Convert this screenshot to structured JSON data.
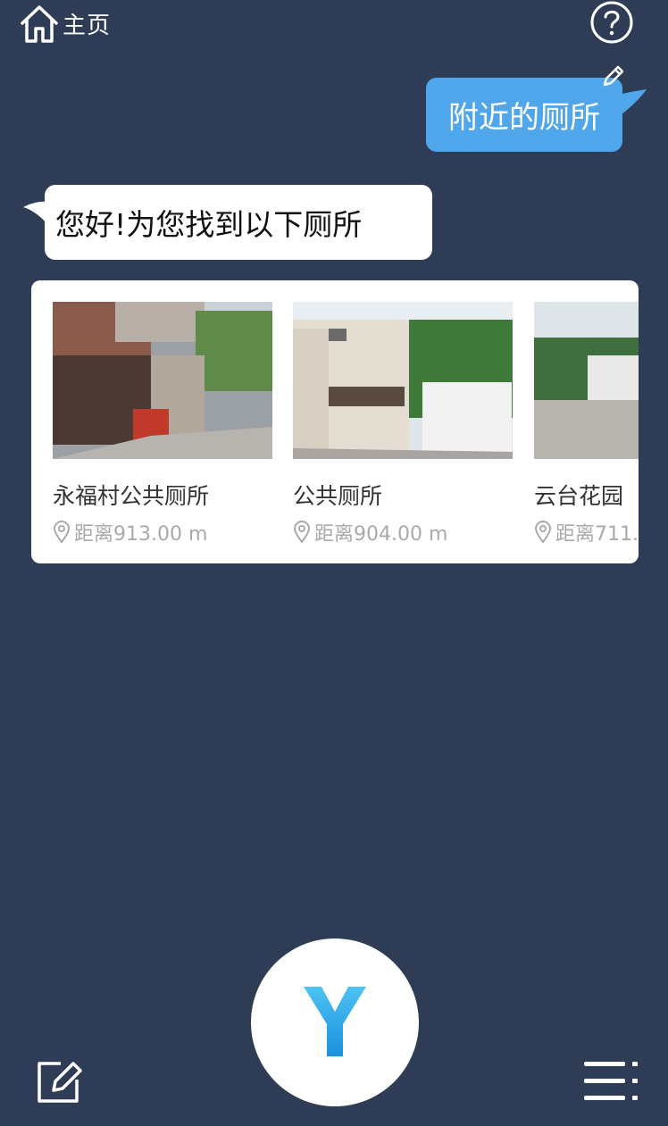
{
  "header": {
    "home_label": "主页",
    "home_icon": "home-icon",
    "help_icon": "question-circle-icon"
  },
  "conversation": {
    "user_query": "附近的厕所",
    "user_edit_icon": "pencil-icon",
    "bot_reply": "您好!为您找到以下厕所"
  },
  "results": [
    {
      "name": "永福村公共厕所",
      "distance": "距离913.00 m",
      "icon": "location-pin-icon"
    },
    {
      "name": "公共厕所",
      "distance": "距离904.00 m",
      "icon": "location-pin-icon"
    },
    {
      "name": "云台花园",
      "distance": "距离711.",
      "icon": "location-pin-icon"
    }
  ],
  "footer": {
    "mic_logo": "Y",
    "edit_icon": "edit-square-icon",
    "menu_icon": "menu-lines-icon"
  },
  "colors": {
    "background": "#2f3c56",
    "user_bubble": "#4fa6ea",
    "bot_bubble": "#ffffff",
    "accent_logo": "#2aa7e6"
  }
}
